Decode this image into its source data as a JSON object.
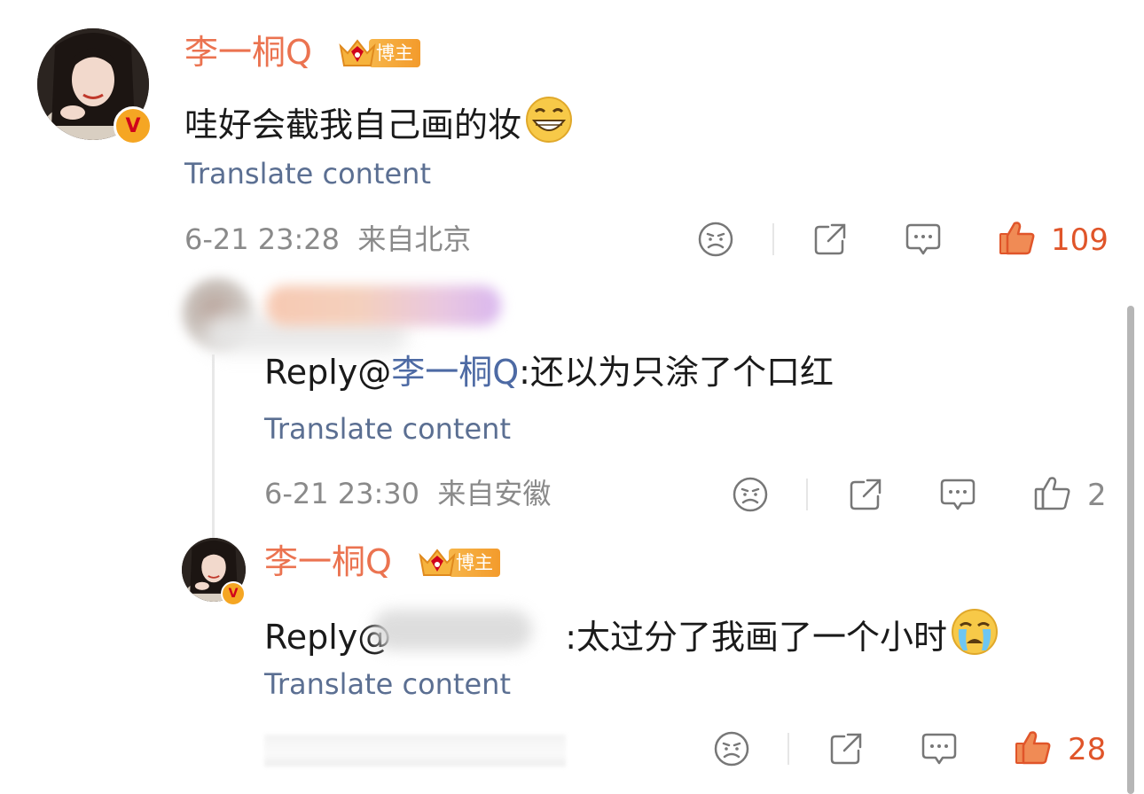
{
  "comment": {
    "author": "李一桐Q",
    "badge_label": "博主",
    "text": "哇好会截我自己画的妆",
    "translate": "Translate content",
    "timestamp": "6-21 23:28",
    "location": "来自北京",
    "likes": "109"
  },
  "reply1": {
    "prefix": "Reply@",
    "mention": "李一桐Q",
    "text": ":还以为只涂了个口红",
    "translate": "Translate content",
    "timestamp": "6-21 23:30",
    "location": "来自安徽",
    "likes": "2"
  },
  "reply2": {
    "author": "李一桐Q",
    "badge_label": "博主",
    "prefix": "Reply@",
    "text": ":太过分了我画了一个小时",
    "translate": "Translate content",
    "likes": "28"
  },
  "colors": {
    "accent": "#eb7350",
    "like_active": "#e0552a",
    "link": "#5b6f92"
  },
  "icons": [
    "angry-face-icon",
    "share-icon",
    "comment-icon",
    "thumbs-up-icon",
    "grin-emoji-icon",
    "crying-emoji-icon",
    "crown-icon",
    "verified-v-icon"
  ]
}
